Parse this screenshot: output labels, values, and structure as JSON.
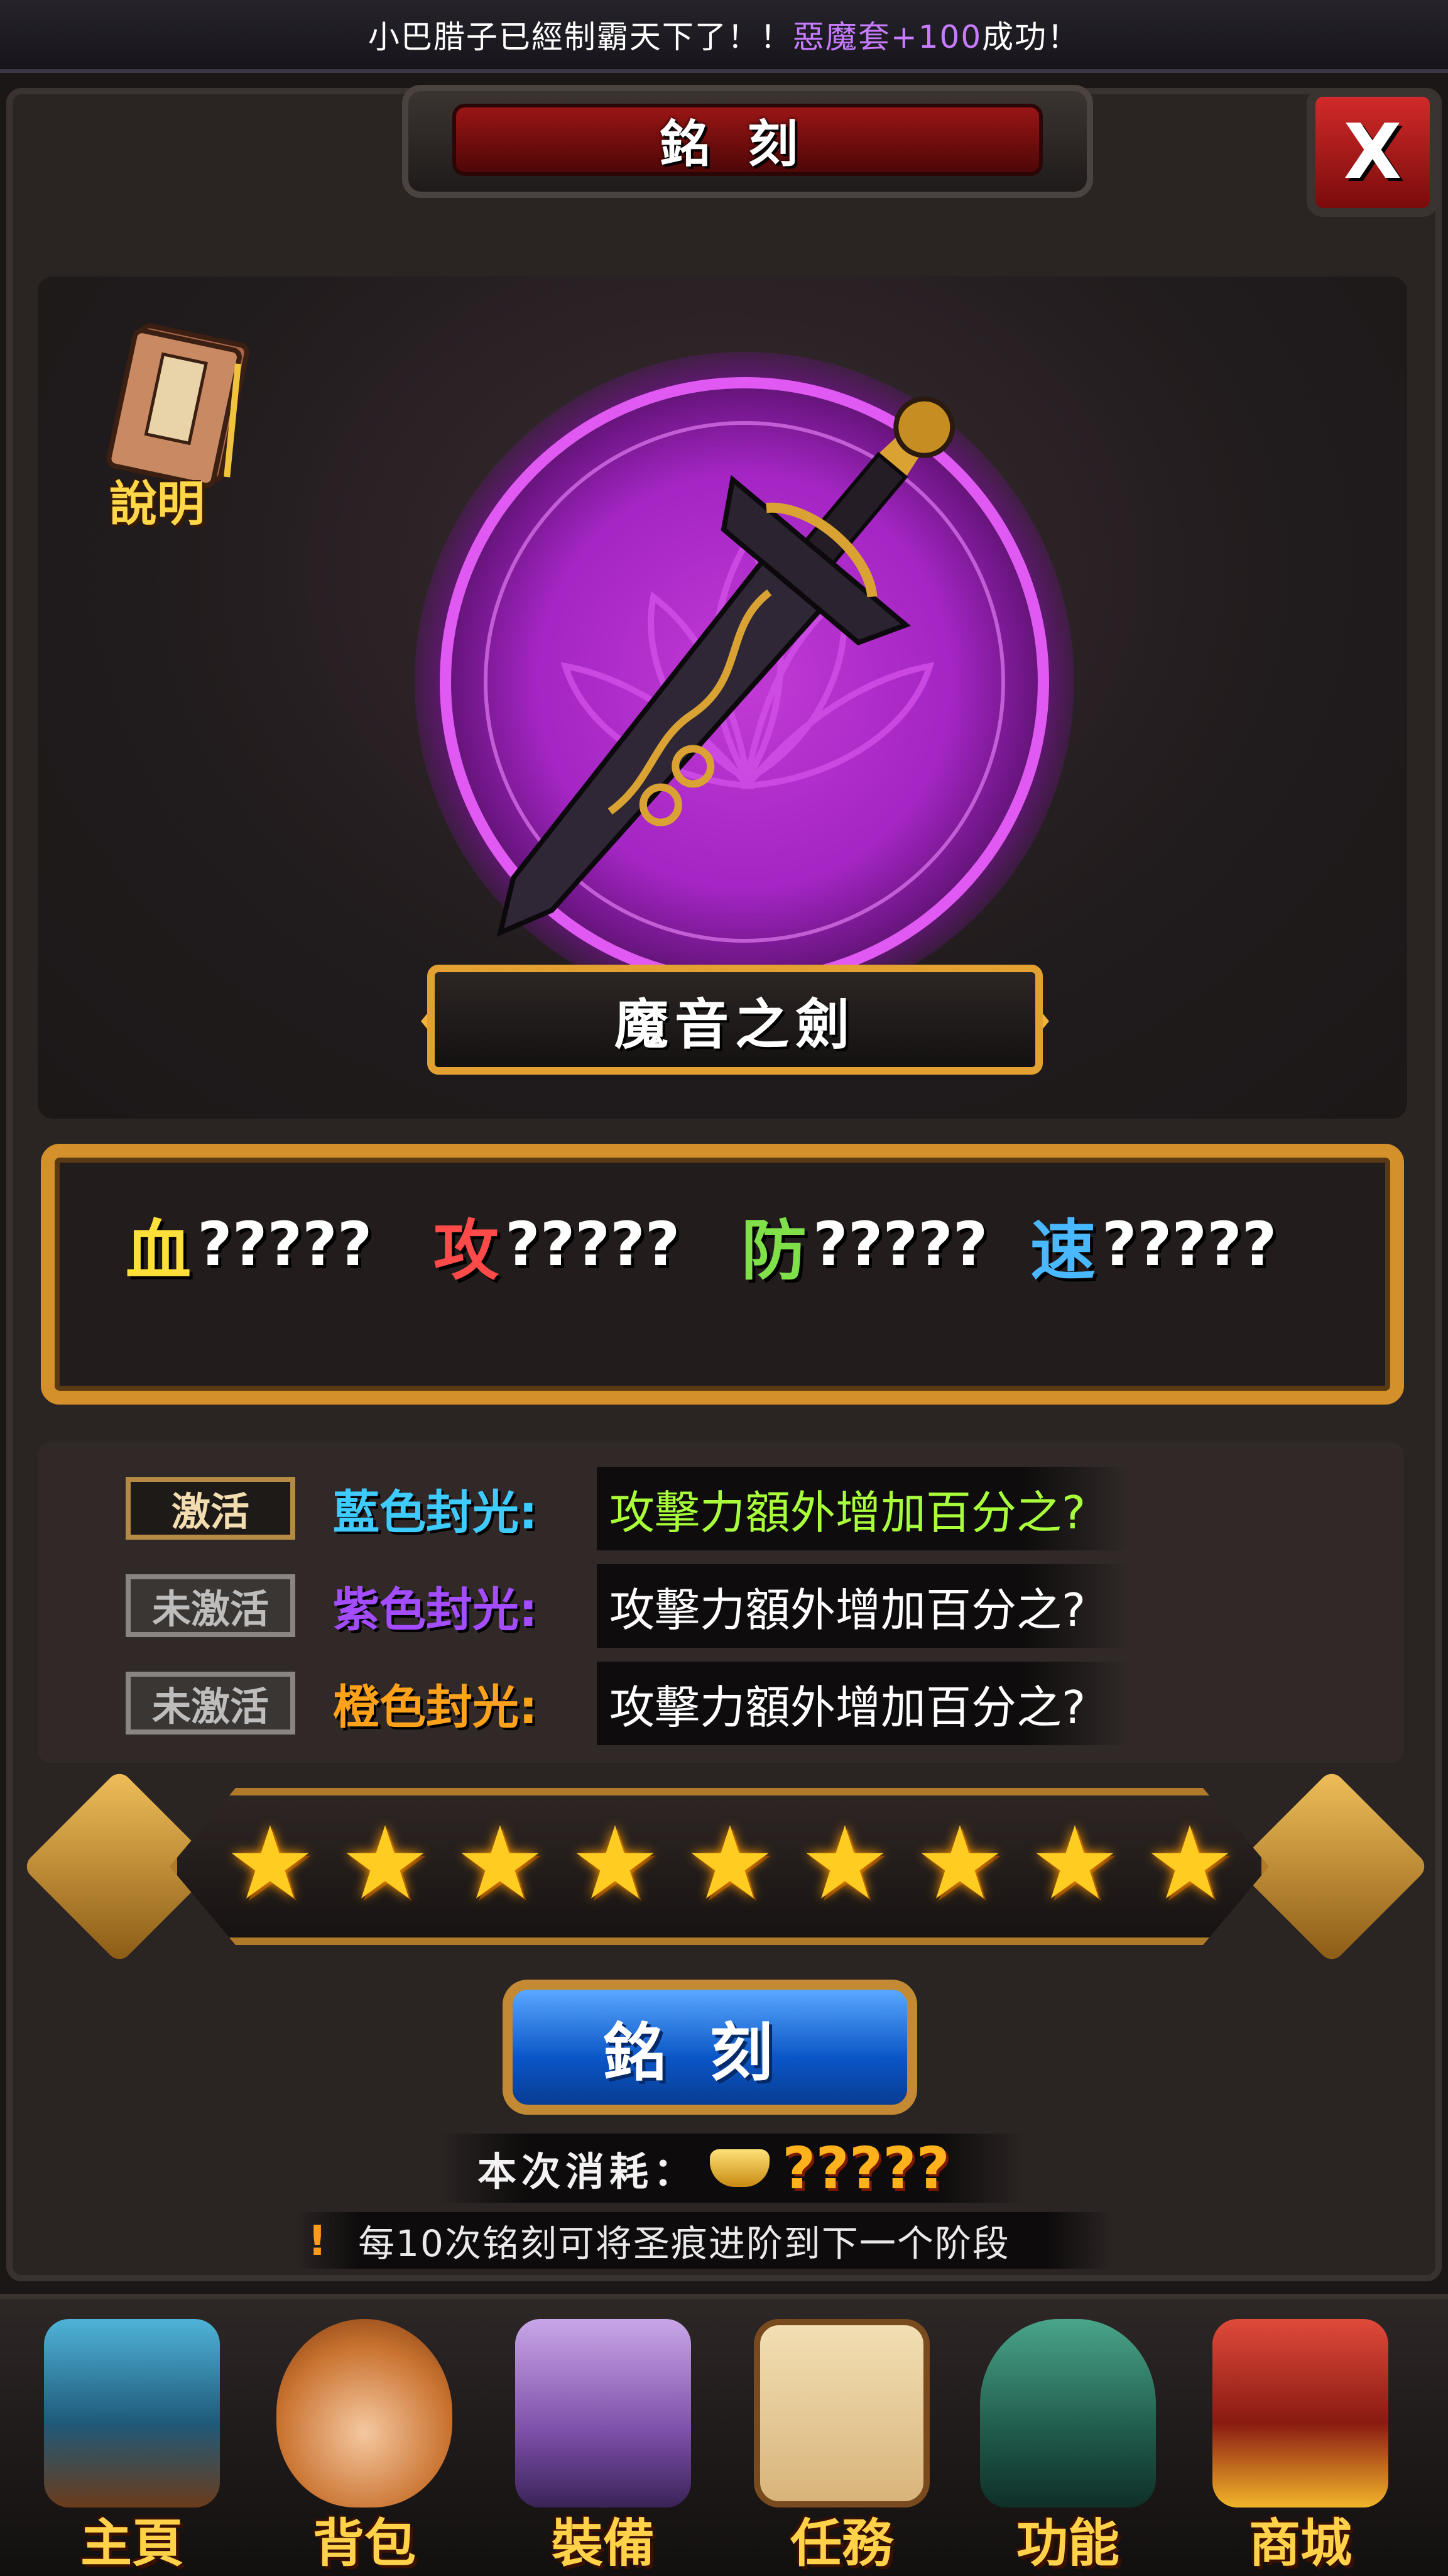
{
  "broadcast": {
    "prefix": "小巴腊子已經制霸天下了！！",
    "highlight": "惡魔套+100",
    "suffix": "成功！"
  },
  "header": {
    "title": "銘刻",
    "close_label": "X"
  },
  "help": {
    "label": "說明",
    "icon": "book-icon"
  },
  "weapon": {
    "name": "魔音之劍",
    "glow_color": "#c23ad6"
  },
  "stats": [
    {
      "label": "血",
      "value": "?????",
      "color": "#ffe03a"
    },
    {
      "label": "攻",
      "value": "?????",
      "color": "#ff4a4a"
    },
    {
      "label": "防",
      "value": "?????",
      "color": "#7fe04a"
    },
    {
      "label": "速",
      "value": "?????",
      "color": "#4ab8ff"
    }
  ],
  "activations": [
    {
      "status": "激活",
      "active": true,
      "name": "藍色封光:",
      "desc": "攻擊力額外增加百分之?",
      "name_color": "#3ecbff",
      "desc_color": "#a8ff3a"
    },
    {
      "status": "未激活",
      "active": false,
      "name": "紫色封光:",
      "desc": "攻擊力額外增加百分之?",
      "name_color": "#a44cff",
      "desc_color": "#ffffff"
    },
    {
      "status": "未激活",
      "active": false,
      "name": "橙色封光:",
      "desc": "攻擊力額外增加百分之?",
      "name_color": "#ffa21a",
      "desc_color": "#ffffff"
    }
  ],
  "stars": {
    "filled": 9,
    "total": 9
  },
  "engrave": {
    "button_label": "銘刻"
  },
  "cost": {
    "label": "本次消耗：",
    "value": "?????",
    "icon": "gold-ingot-icon"
  },
  "tip": {
    "icon": "!",
    "text": "每10次铭刻可将圣痕进阶到下一个阶段"
  },
  "nav": [
    {
      "label": "主頁",
      "icon": "pagoda-icon"
    },
    {
      "label": "背包",
      "icon": "bag-icon"
    },
    {
      "label": "裝備",
      "icon": "armor-icon"
    },
    {
      "label": "任務",
      "icon": "scroll-icon"
    },
    {
      "label": "功能",
      "icon": "bell-icon"
    },
    {
      "label": "商城",
      "icon": "treasure-chest-icon"
    }
  ]
}
